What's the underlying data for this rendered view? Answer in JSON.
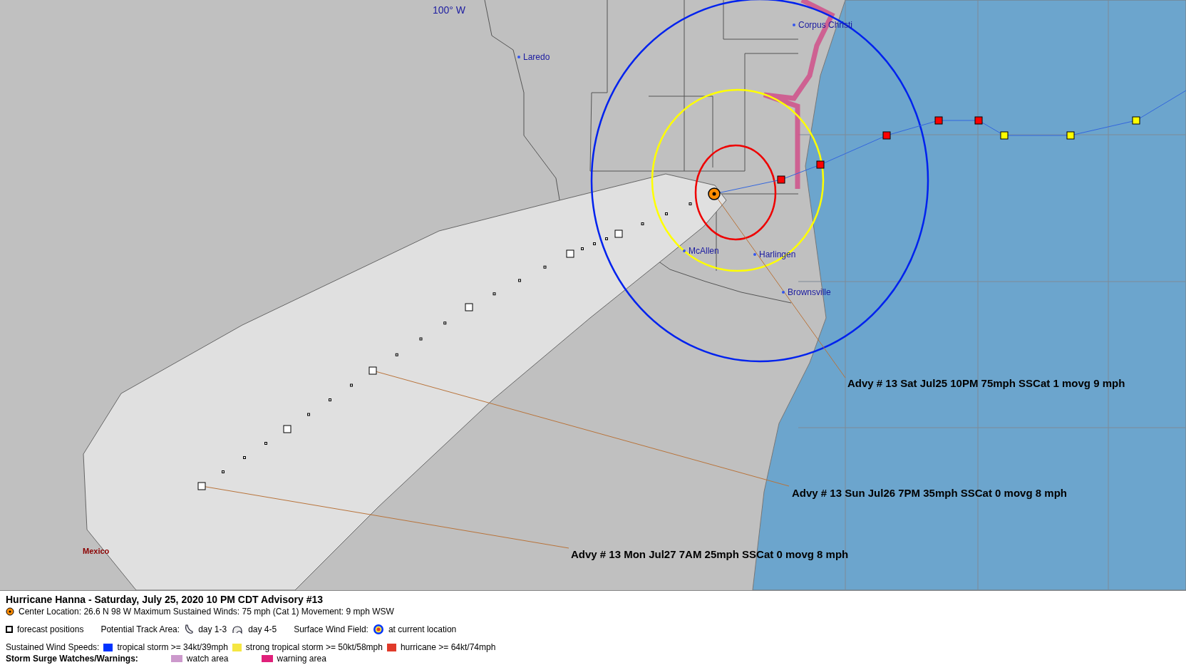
{
  "map": {
    "longitude_label": "100° W",
    "cities": [
      {
        "name": "Laredo"
      },
      {
        "name": "Corpus Christi"
      },
      {
        "name": "McAllen"
      },
      {
        "name": "Harlingen"
      },
      {
        "name": "Brownsville"
      }
    ],
    "region_label": "Mexico",
    "past_track": [
      {
        "color": "#ff0000"
      },
      {
        "color": "#ff0000"
      },
      {
        "color": "#ff0000"
      },
      {
        "color": "#ff0000"
      },
      {
        "color": "#ff0000"
      },
      {
        "color": "#ffff00"
      },
      {
        "color": "#ffff00"
      },
      {
        "color": "#ffff00"
      }
    ],
    "advisories": [
      "Advy # 13 Sat Jul25 10PM  75mph SSCat 1 movg 9 mph",
      "Advy # 13 Sun Jul26 7PM  35mph SSCat 0 movg 8 mph",
      "Advy # 13 Mon Jul27 7AM  25mph SSCat 0 movg 8 mph"
    ]
  },
  "legend": {
    "title": "Hurricane Hanna  -  Saturday, July 25, 2020  10 PM CDT   Advisory #13",
    "center": "Center Location: 26.6 N  98 W   Maximum Sustained Winds: 75 mph (Cat 1) Movement: 9 mph WSW",
    "forecast_positions": "forecast positions",
    "track_area": {
      "label": "Potential Track Area:",
      "day_1_3": "day 1-3",
      "day_4_5": "day 4-5"
    },
    "wind_field": {
      "label": "Surface Wind Field:",
      "text": "at current location"
    },
    "wind_speeds": {
      "label": "Sustained Wind Speeds:",
      "items": [
        {
          "text": "tropical storm >= 34kt/39mph",
          "color": "#0033ff"
        },
        {
          "text": "strong tropical storm >= 50kt/58mph",
          "color": "#f5e642"
        },
        {
          "text": "hurricane >= 64kt/74mph",
          "color": "#e03a2a"
        }
      ]
    },
    "surge": {
      "label": "Storm Surge Watches/Warnings:",
      "items": [
        {
          "text": "watch area",
          "color": "#cc99cc"
        },
        {
          "text": "warning area",
          "color": "#e0207a"
        }
      ]
    }
  }
}
